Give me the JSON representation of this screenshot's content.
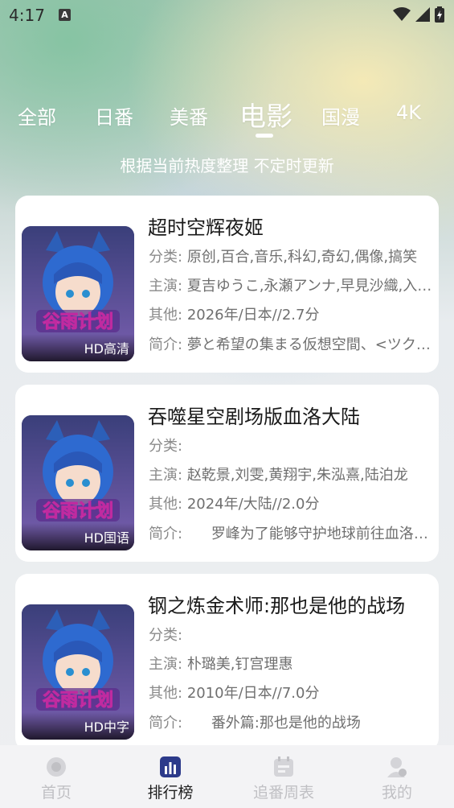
{
  "status_bar": {
    "time": "4:17",
    "notif": "A"
  },
  "tabs": [
    {
      "label": "全部"
    },
    {
      "label": "日番"
    },
    {
      "label": "美番"
    },
    {
      "label": "电影"
    },
    {
      "label": "国漫"
    },
    {
      "label": "4K"
    }
  ],
  "active_tab": "电影",
  "subtitle": "根据当前热度整理 不定时更新",
  "labels": {
    "category": "分类:",
    "cast": "主演:",
    "other": "其他:",
    "intro": "简介:"
  },
  "poster_brand": "谷雨计划",
  "items": [
    {
      "title": "超时空辉夜姬",
      "badge": "HD高清",
      "category": "原创,百合,音乐,科幻,奇幻,偶像,搞笑",
      "cast": "夏吉ゆうこ,永瀬アンナ,早見沙織,入野自由",
      "other": "2026年/日本//2.7分",
      "intro": "夢と希望の集まる仮想空間、<ツクヨミ>"
    },
    {
      "title": "吞噬星空剧场版血洛大陆",
      "badge": "HD国语",
      "category": "",
      "cast": "赵乾景,刘雯,黄翔宇,朱泓熹,陆泊龙",
      "other": "2024年/大陆//2.0分",
      "intro": "罗峰为了能够守护地球前往血洛大陆"
    },
    {
      "title": "钢之炼金术师:那也是他的战场",
      "badge": "HD中字",
      "category": "",
      "cast": "朴璐美,钉宫理惠",
      "other": "2010年/日本//7.0分",
      "intro": "番外篇:那也是他的战场"
    }
  ],
  "nav": [
    {
      "label": "首页",
      "icon": "home-icon"
    },
    {
      "label": "排行榜",
      "icon": "chart-icon"
    },
    {
      "label": "追番周表",
      "icon": "calendar-icon"
    },
    {
      "label": "我的",
      "icon": "profile-icon"
    }
  ]
}
